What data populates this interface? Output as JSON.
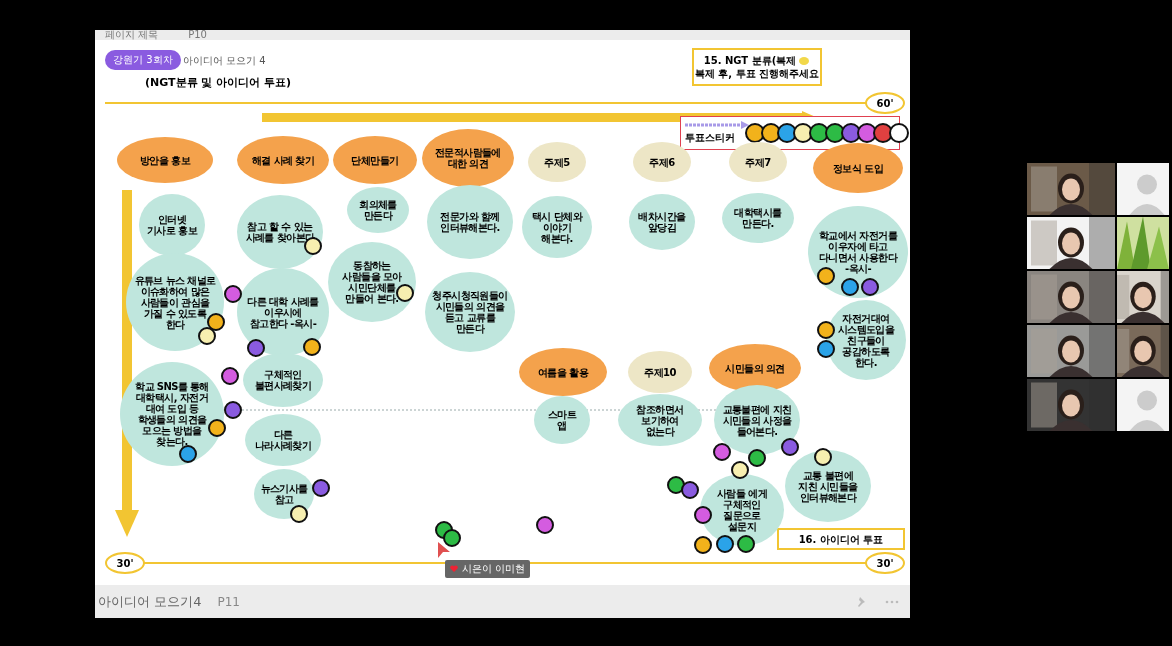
{
  "header": {
    "title": "페이지 제목",
    "page": "P10"
  },
  "badge": "강원기 3회차",
  "subtitle": "아이디어 모으기 4",
  "title": "(NGT분류 및 아이디어 투표)",
  "notes": [
    {
      "lines": [
        "15. NGT 분류(복제",
        "복제 후, 투표 진행해주세요"
      ],
      "sticker": true
    },
    {
      "lines": [
        "16. 아이디어 투표"
      ],
      "sticker": false
    }
  ],
  "time_labels": [
    "60'",
    "30'",
    "30'"
  ],
  "vote_legend": {
    "label": "투표스티커",
    "stickers": [
      {
        "color": "#f2b21b"
      },
      {
        "color": "#f2b21b"
      },
      {
        "color": "#2ba3e8"
      },
      {
        "color": "#f7efb0"
      },
      {
        "color": "#2dbb45"
      },
      {
        "color": "#2dbb45"
      },
      {
        "color": "#8a5be0"
      },
      {
        "color": "#d45ce0"
      },
      {
        "color": "#e04040"
      },
      {
        "color": "#ffffff"
      }
    ]
  },
  "categories": [
    {
      "label": "방안을 홍보",
      "color": "#f4a24c"
    },
    {
      "label": "해결 사례 찾기",
      "color": "#f4a24c"
    },
    {
      "label": "단체만들기",
      "color": "#f4a24c"
    },
    {
      "label": "전문적사람들에 대한 의견",
      "color": "#f4a24c"
    },
    {
      "label": "주제5",
      "color": "#ede6c6"
    },
    {
      "label": "주제6",
      "color": "#ede6c6"
    },
    {
      "label": "주제7",
      "color": "#ede6c6"
    },
    {
      "label": "정보식 도입",
      "color": "#f4a24c"
    },
    {
      "label": "여름을 활용",
      "color": "#f4a24c"
    },
    {
      "label": "주제10",
      "color": "#ede6c6"
    },
    {
      "label": "시민들의 의견",
      "color": "#f4a24c"
    }
  ],
  "ideas": [
    "인터넷 기사로 홍보",
    "참고 할 수 있는 사례를 찾아본다",
    "회의체를 만든다",
    "전문가와 함께 인터뷰해본다.",
    "택시 단체와 이야기 해본다.",
    "배차시간을 앞당김",
    "대학택시를 만든다.",
    "학교에서 자전거를 이우자에 타고 다니면서 사용한다 -옥시-",
    "유튜브 뉴스 채널로 이슈화하여 많은 사람들이 관심을 가질 수 있도록 한다",
    "다른 대학 사례를 이우시에 참고한다 -옥시-",
    "동참하는 사람들을 모아 시민단체를 만들어 본다.",
    "청주시청직원들이 시민들의 의견을 듣고 교류를 만든다",
    "자전거대여 시스템도입을 친구들이 공감하도록 한다.",
    "학교 SNS를 통해 대학택시, 자전거 대여 도입 등 학생들의 의견을 모으는 방법을 찾는다.",
    "구체적인 불편사례찾기",
    "스마트 앱",
    "참조하면서 보기하여 없는다",
    "교통불편에 지친 시민들의 사정을 들어본다.",
    "다른 나라사례찾기",
    "뉴스기사를 참고",
    "사람들 에게 구체적인 질문으로 설문지",
    "교통 불편에 지친 시민들을 인터뷰해본다"
  ],
  "stickers": [
    {
      "color": "#f7efb0"
    },
    {
      "color": "#f7efb0"
    },
    {
      "color": "#d45ce0"
    },
    {
      "color": "#f2b21b"
    },
    {
      "color": "#f7efb0"
    },
    {
      "color": "#8a5be0"
    },
    {
      "color": "#f2b21b"
    },
    {
      "color": "#d45ce0"
    },
    {
      "color": "#8a5be0"
    },
    {
      "color": "#f2b21b"
    },
    {
      "color": "#2ba3e8"
    },
    {
      "color": "#8a5be0"
    },
    {
      "color": "#f7efb0"
    },
    {
      "color": "#f2b21b"
    },
    {
      "color": "#2ba3e8"
    },
    {
      "color": "#8a5be0"
    },
    {
      "color": "#f2b21b"
    },
    {
      "color": "#2ba3e8"
    },
    {
      "color": "#d45ce0"
    },
    {
      "color": "#2dbb45"
    },
    {
      "color": "#f7efb0"
    },
    {
      "color": "#8a5be0"
    },
    {
      "color": "#f7efb0"
    },
    {
      "color": "#2dbb45"
    },
    {
      "color": "#8a5be0"
    },
    {
      "color": "#d45ce0"
    },
    {
      "color": "#f2b21b"
    },
    {
      "color": "#2ba3e8"
    },
    {
      "color": "#2dbb45"
    },
    {
      "color": "#2dbb45"
    },
    {
      "color": "#2dbb45"
    },
    {
      "color": "#d45ce0"
    }
  ],
  "cursor": {
    "label": "시은이 이미현"
  },
  "footer": {
    "title": "아이디어 모으기4",
    "page": "P11"
  },
  "participants": [
    {
      "kind": "camera"
    },
    {
      "kind": "avatar"
    },
    {
      "kind": "camera"
    },
    {
      "kind": "scenery"
    },
    {
      "kind": "camera"
    },
    {
      "kind": "camera"
    },
    {
      "kind": "camera"
    },
    {
      "kind": "camera"
    },
    {
      "kind": "camera"
    },
    {
      "kind": "avatar"
    }
  ]
}
